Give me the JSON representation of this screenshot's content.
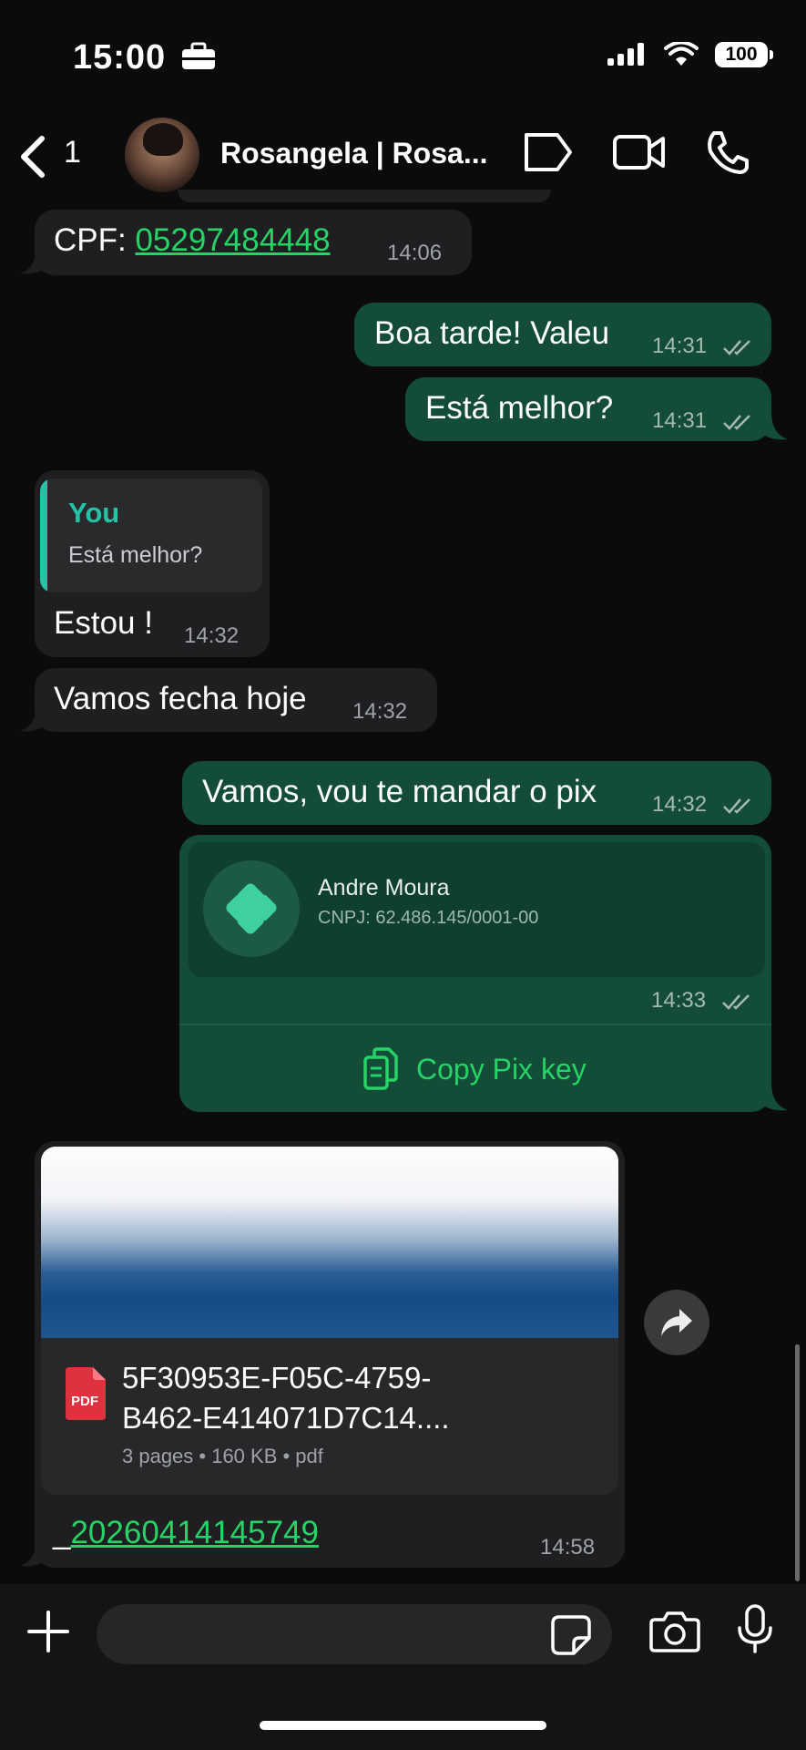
{
  "status_bar": {
    "time": "15:00",
    "battery": "100"
  },
  "header": {
    "unread_count": "1",
    "contact_name": "Rosangela | Rosa..."
  },
  "messages": {
    "cpf": {
      "label": "CPF: ",
      "number": "05297484448",
      "time": "14:06"
    },
    "m1": {
      "text": "Boa tarde! Valeu",
      "time": "14:31"
    },
    "m2": {
      "text": "Está melhor?",
      "time": "14:31"
    },
    "m3": {
      "quote_author": "You",
      "quote_text": "Está melhor?",
      "text": "Estou !",
      "time": "14:32"
    },
    "m4": {
      "text": "Vamos fecha hoje",
      "time": "14:32"
    },
    "m5": {
      "text": "Vamos, vou te mandar o pix",
      "time": "14:32"
    },
    "pix": {
      "name": "Andre Moura",
      "cnpj": "CNPJ: 62.486.145/0001-00",
      "time": "14:33",
      "action": "Copy Pix key"
    },
    "doc": {
      "title_line1": "5F30953E-F05C-4759-",
      "title_line2": "B462-E414071D7C14....",
      "meta": "3 pages • 160 KB • pdf",
      "pdf_label": "PDF",
      "caption_prefix": "_",
      "caption_link": "20260414145749",
      "time": "14:58"
    }
  },
  "colors": {
    "outgoing": "#134d37",
    "incoming": "#1f1f21",
    "accent": "#25d366",
    "quote": "#24c3a6"
  },
  "icons": [
    "back-chevron-icon",
    "label-tag-icon",
    "video-call-icon",
    "phone-icon",
    "pix-logo-icon",
    "copy-icon",
    "pdf-file-icon",
    "forward-icon",
    "plus-icon",
    "sticker-icon",
    "camera-icon",
    "microphone-icon",
    "double-check-icon",
    "signal-icon",
    "wifi-icon",
    "briefcase-icon"
  ]
}
